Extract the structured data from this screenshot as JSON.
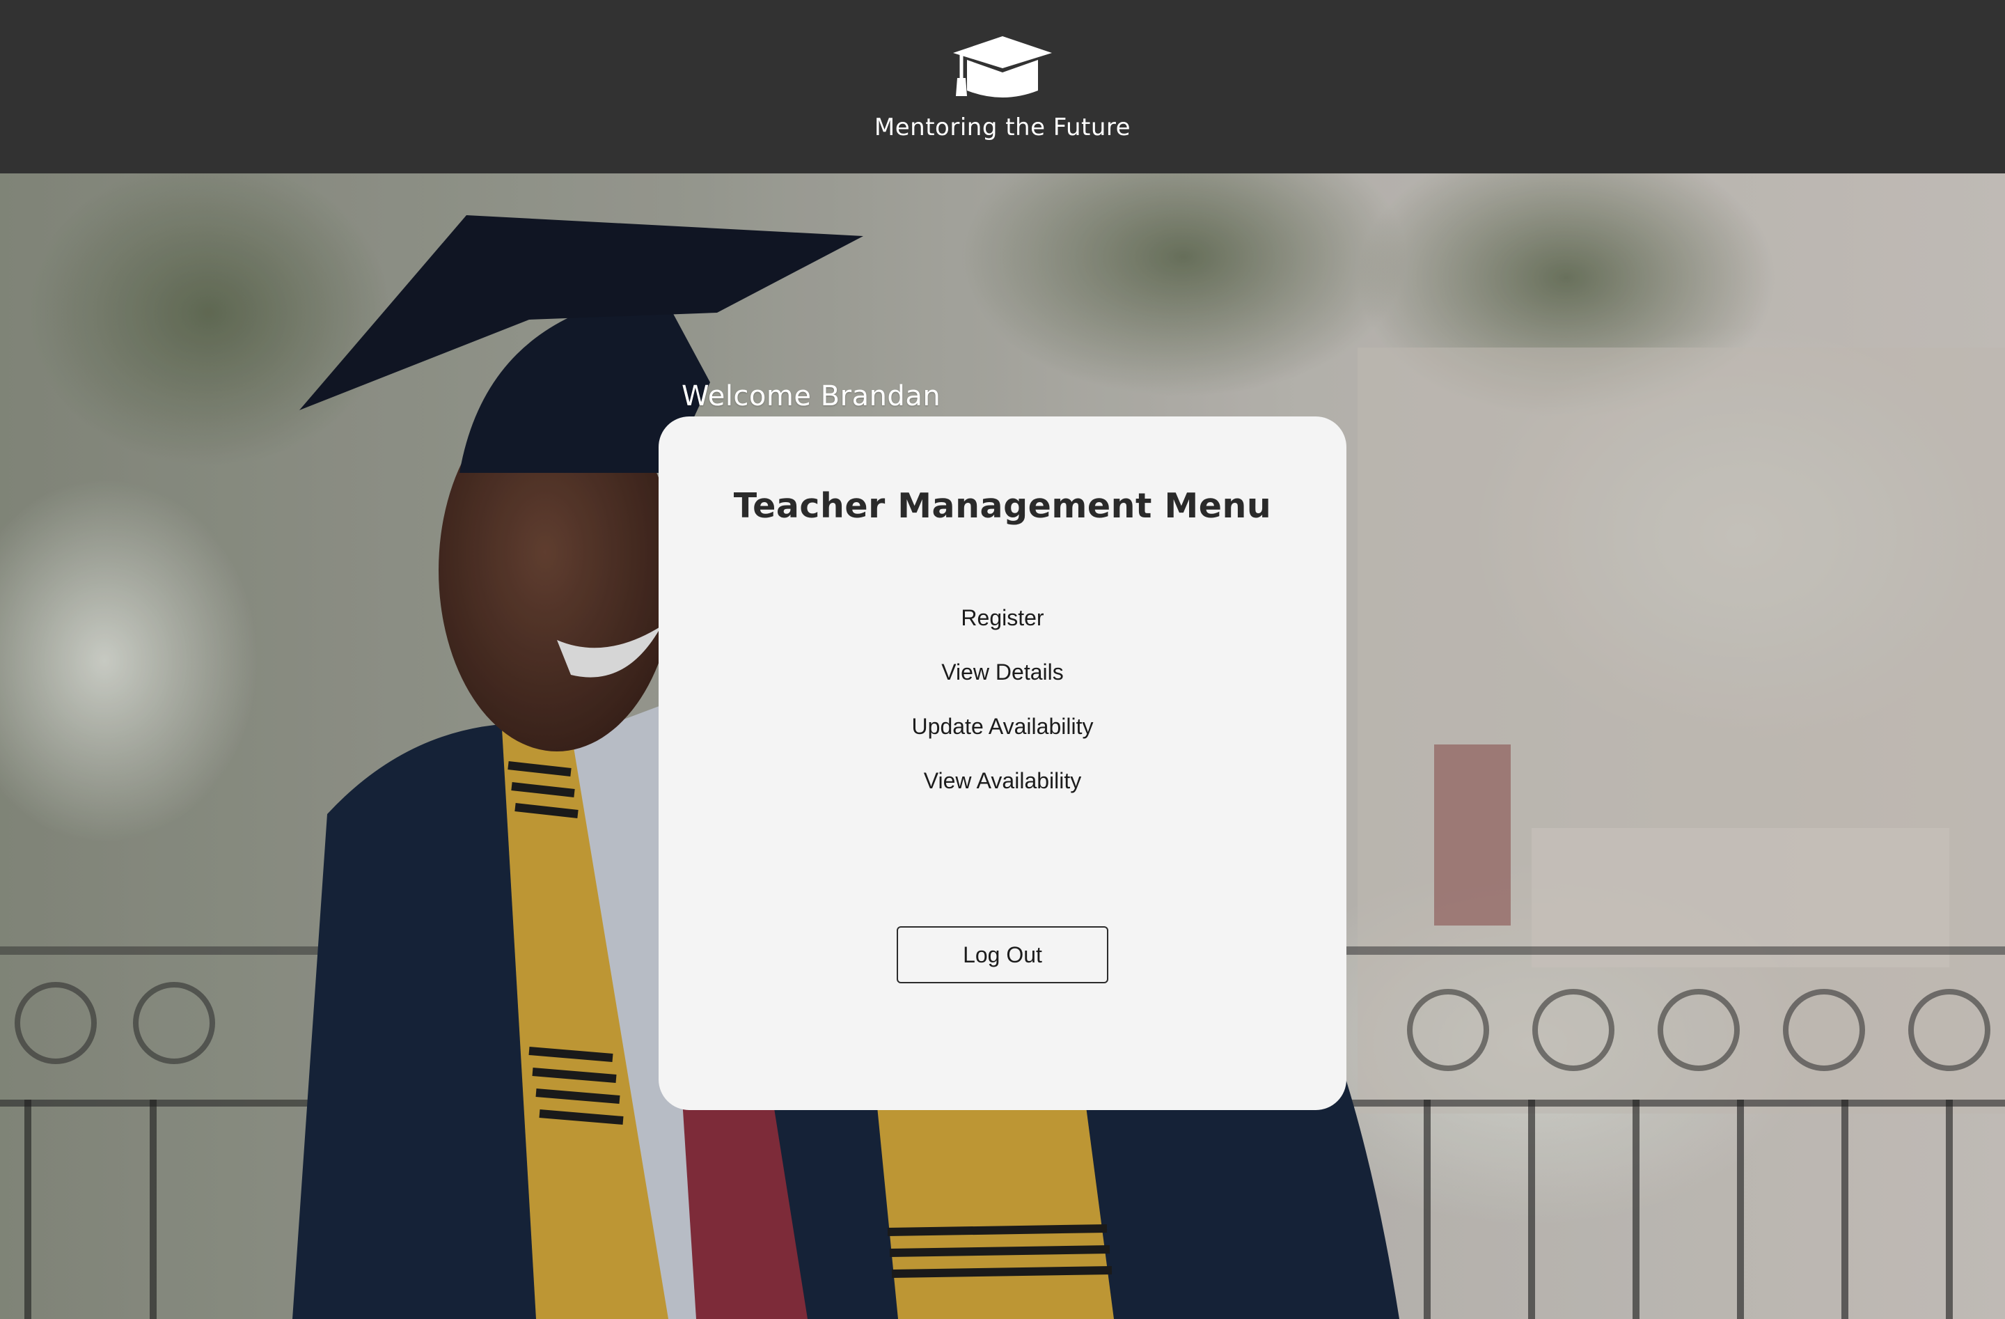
{
  "header": {
    "logo_icon": "graduation-cap-icon",
    "brand_name": "Mentoring the Future",
    "background_color": "#323232"
  },
  "hero": {
    "description_icon": "graduate-photo"
  },
  "welcome": {
    "text": "Welcome Brandan"
  },
  "card": {
    "title": "Teacher Management Menu",
    "menu": [
      {
        "label": "Register"
      },
      {
        "label": "View Details"
      },
      {
        "label": "Update Availability"
      },
      {
        "label": "View Availability"
      }
    ],
    "logout_label": "Log Out",
    "background_color": "#f4f4f4"
  }
}
